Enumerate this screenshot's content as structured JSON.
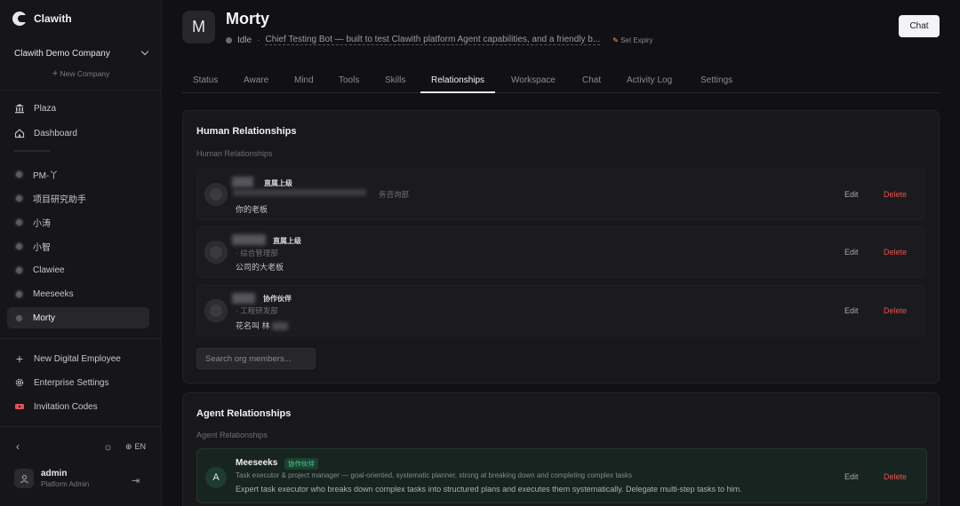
{
  "app": {
    "name": "Clawith"
  },
  "sidebar": {
    "company": "Clawith Demo Company",
    "new_company": "New Company",
    "main_nav": [
      {
        "label": "Plaza",
        "icon": "bank-icon"
      },
      {
        "label": "Dashboard",
        "icon": "home-icon"
      }
    ],
    "agents": [
      {
        "label": "PM-丫"
      },
      {
        "label": "项目研究助手"
      },
      {
        "label": "小涛"
      },
      {
        "label": "小智"
      },
      {
        "label": "Clawiee"
      },
      {
        "label": "Meeseeks"
      },
      {
        "label": "Morty",
        "active": true
      }
    ],
    "footer_nav": [
      {
        "label": "New Digital Employee",
        "icon": "plus-icon"
      },
      {
        "label": "Enterprise Settings",
        "icon": "gear-icon"
      },
      {
        "label": "Invitation Codes",
        "icon": "ticket-icon"
      }
    ],
    "language": "EN",
    "user": {
      "name": "admin",
      "role": "Platform Admin"
    }
  },
  "header": {
    "avatar_letter": "M",
    "name": "Morty",
    "status": "Idle",
    "description": "Chief Testing Bot — built to test Clawith platform Agent capabilities, and a friendly b...",
    "set_expiry": "Set Expiry",
    "chat_button": "Chat"
  },
  "tabs": [
    {
      "label": "Status"
    },
    {
      "label": "Aware"
    },
    {
      "label": "Mind"
    },
    {
      "label": "Tools"
    },
    {
      "label": "Skills"
    },
    {
      "label": "Relationships",
      "active": true
    },
    {
      "label": "Workspace"
    },
    {
      "label": "Chat"
    },
    {
      "label": "Activity Log"
    },
    {
      "label": "Settings"
    }
  ],
  "human": {
    "title": "Human Relationships",
    "subtitle": "Human Relationships",
    "rows": [
      {
        "tag": "直属上级",
        "dept": "务咨询部",
        "note": "你的老板"
      },
      {
        "tag": "直属上级",
        "dept": "· 综合管理部",
        "note": "公司的大老板"
      },
      {
        "tag": "协作伙伴",
        "dept": "· 工程研发部",
        "note": "花名叫 林"
      }
    ],
    "edit": "Edit",
    "delete": "Delete",
    "search_placeholder": "Search org members..."
  },
  "agent_rel": {
    "title": "Agent Relationships",
    "subtitle": "Agent Relationships",
    "rows": [
      {
        "avatar": "A",
        "name": "Meeseeks",
        "tag": "协作伙伴",
        "role": "Task executor & project manager — goal-oriented, systematic planner, strong at breaking down and completing complex tasks",
        "description": "Expert task executor who breaks down complex tasks into structured plans and executes them systematically. Delegate multi-step tasks to him."
      }
    ]
  },
  "colors": {
    "accent_green": "#4fd18b",
    "danger": "#e5534b",
    "background": "#111113"
  }
}
